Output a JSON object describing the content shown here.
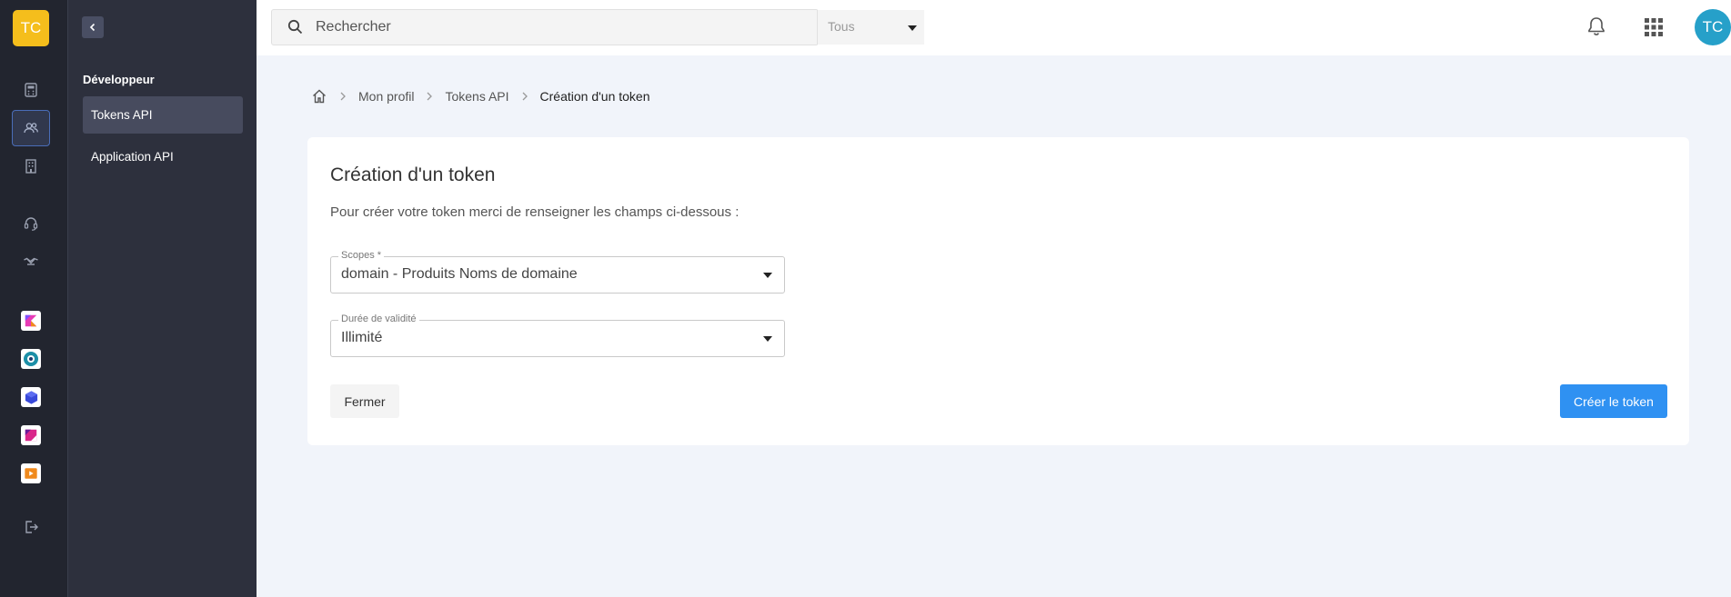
{
  "rail": {
    "logo_text": "TC",
    "icons": [
      "calculator-icon",
      "users-icon",
      "building-icon",
      "headset-icon",
      "handshake-icon"
    ],
    "apps": [
      "kotlin-app-icon",
      "disc-app-icon",
      "cube-app-icon",
      "slash-app-icon",
      "video-app-icon"
    ],
    "logout_icon": "logout-icon"
  },
  "subnav": {
    "section_title": "Développeur",
    "items": [
      {
        "label": "Tokens API",
        "active": true
      },
      {
        "label": "Application API",
        "active": false
      }
    ]
  },
  "topbar": {
    "search_placeholder": "Rechercher",
    "scope_value": "Tous",
    "avatar_initials": "TC"
  },
  "breadcrumb": {
    "items": [
      "Mon profil",
      "Tokens API"
    ],
    "current": "Création d'un token"
  },
  "card": {
    "title": "Création d'un token",
    "description": "Pour créer votre token merci de renseigner les champs ci-dessous :",
    "fields": [
      {
        "label": "Scopes *",
        "value": "domain - Produits Noms de domaine"
      },
      {
        "label": "Durée de validité",
        "value": "Illimité"
      }
    ],
    "close_label": "Fermer",
    "submit_label": "Créer le token"
  },
  "colors": {
    "accent": "#2f91f2",
    "logo": "#f5be1c",
    "avatar": "#26a0c9",
    "sidebar": "#2d303d",
    "rail": "#22252f"
  }
}
